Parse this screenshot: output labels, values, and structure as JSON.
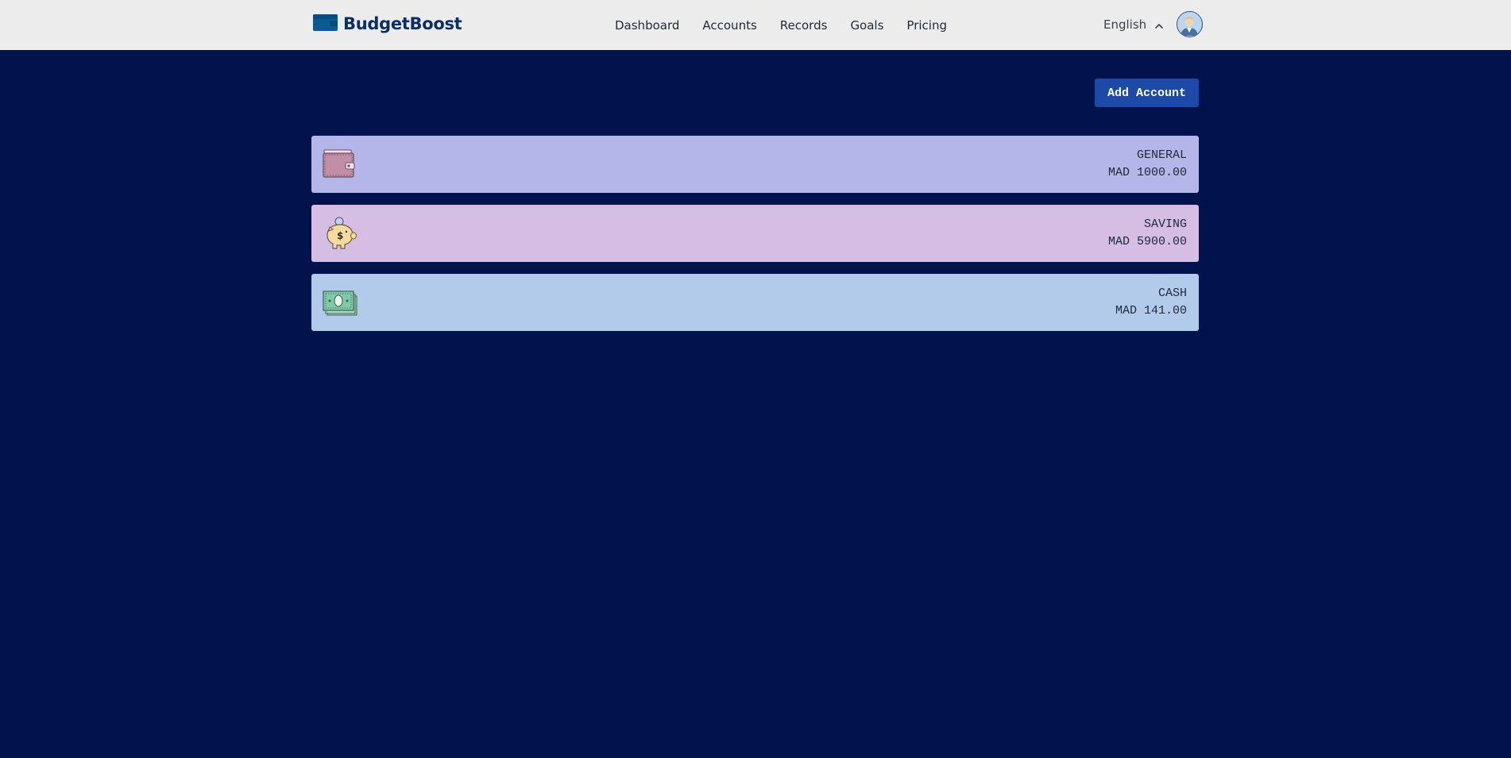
{
  "header": {
    "brand": "BudgetBoost",
    "nav": [
      "Dashboard",
      "Accounts",
      "Records",
      "Goals",
      "Pricing"
    ],
    "language": "English"
  },
  "main": {
    "add_account_label": "Add Account",
    "accounts": [
      {
        "name": "GENERAL",
        "balance": "MAD 1000.00",
        "icon": "wallet-icon",
        "color": "#b4b6ea"
      },
      {
        "name": "SAVING",
        "balance": "MAD 5900.00",
        "icon": "piggy-bank-icon",
        "color": "#d6bde4"
      },
      {
        "name": "CASH",
        "balance": "MAD 141.00",
        "icon": "cash-stack-icon",
        "color": "#b3cbea"
      }
    ]
  },
  "colors": {
    "background": "#02124c",
    "navbar": "#ececec",
    "brand": "#0b2e63",
    "button": "#1d4aa6"
  }
}
